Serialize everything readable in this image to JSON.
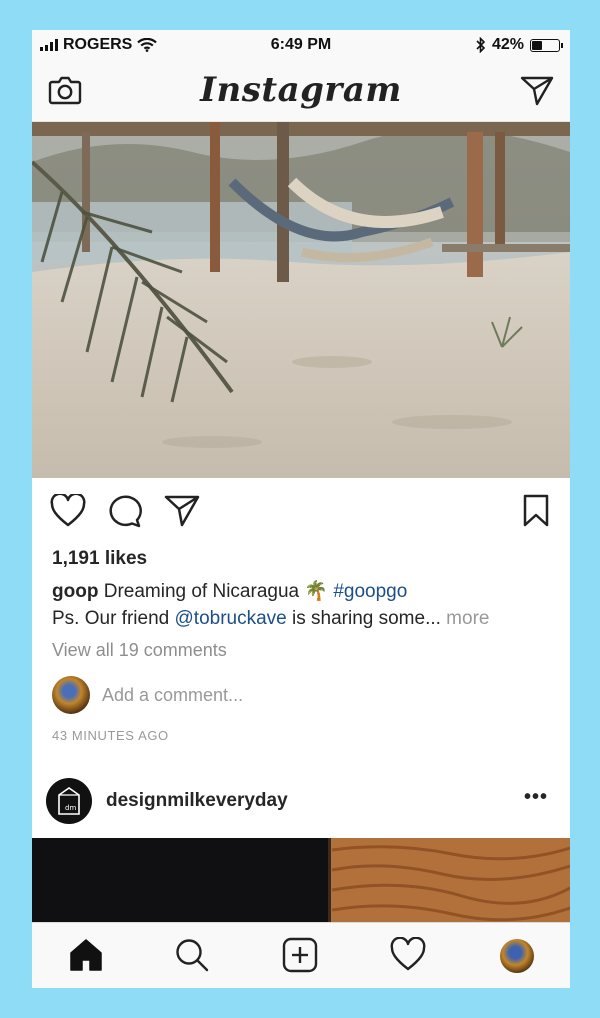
{
  "status_bar": {
    "carrier": "ROGERS",
    "time": "6:49 PM",
    "battery_percent": "42%",
    "battery_level": 0.42,
    "icons": [
      "signal-bars-icon",
      "wifi-icon",
      "bluetooth-icon",
      "battery-icon"
    ]
  },
  "header": {
    "logo_text": "Instagram",
    "left_icon": "camera-icon",
    "right_icon": "direct-message-icon"
  },
  "post": {
    "image_alt": "beach hammocks photo",
    "actions": [
      "heart-icon",
      "comment-icon",
      "share-icon",
      "bookmark-icon"
    ],
    "likes": "1,191 likes",
    "caption_user": "goop",
    "caption_text": " Dreaming of Nicaragua ",
    "caption_emoji": "🌴",
    "caption_hashtag": "#goopgo",
    "caption_line2_prefix": "Ps. Our friend ",
    "caption_mention": "@tobruckave",
    "caption_line2_suffix": " is sharing some...",
    "more_label": " more",
    "view_comments": "View all 19 comments",
    "add_comment_placeholder": "Add a comment...",
    "timestamp": "43 MINUTES AGO"
  },
  "post2": {
    "username": "designmilkeveryday",
    "avatar_text": "dm",
    "more_icon": "•••"
  },
  "tabbar": {
    "items": [
      "home-icon",
      "search-icon",
      "add-post-icon",
      "activity-heart-icon",
      "profile-avatar"
    ]
  },
  "colors": {
    "background_frame": "#8fdcf7",
    "link_blue": "#1c4f8a",
    "muted_gray": "#999999"
  }
}
